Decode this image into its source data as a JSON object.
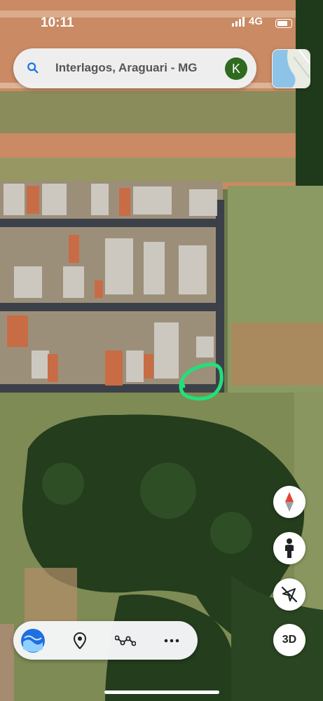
{
  "status_bar": {
    "time": "10:11",
    "network": "4G"
  },
  "search": {
    "text": "Interlagos, Araguari - MG",
    "avatar_letter": "K",
    "avatar_color": "#2f6a1e"
  },
  "map": {
    "type": "satellite",
    "annotation_color": "#22e07a"
  },
  "controls": {
    "compass_icon": "compass-icon",
    "street_view_icon": "pegman-icon",
    "location_icon": "location-arrow-off-icon",
    "three_d_label": "3D"
  },
  "bottom_bar": {
    "icons": [
      "gemini-logo-icon",
      "pin-icon",
      "route-icon",
      "more-icon"
    ]
  }
}
